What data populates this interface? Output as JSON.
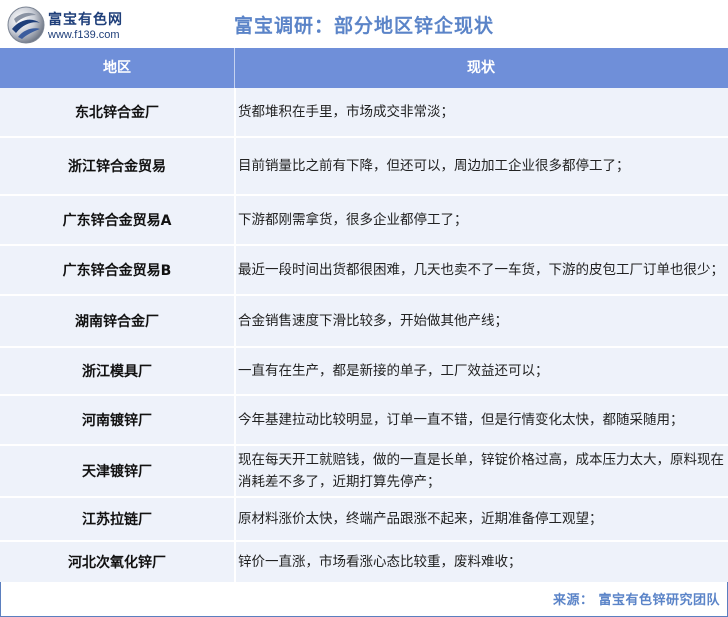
{
  "header": {
    "brand_name": "富宝有色网",
    "brand_url": "www.f139.com",
    "title": "富宝调研：部分地区锌企现状"
  },
  "table": {
    "columns": [
      "地区",
      "现状"
    ],
    "rows": [
      {
        "region": "东北锌合金厂",
        "status": "货都堆积在手里，市场成交非常淡；"
      },
      {
        "region": "浙江锌合金贸易",
        "status": "目前销量比之前有下降，但还可以，周边加工企业很多都停工了；"
      },
      {
        "region": "广东锌合金贸易A",
        "status": "下游都刚需拿货，很多企业都停工了；"
      },
      {
        "region": "广东锌合金贸易B",
        "status": "最近一段时间出货都很困难，几天也卖不了一车货，下游的皮包工厂订单也很少；"
      },
      {
        "region": "湖南锌合金厂",
        "status": "合金销售速度下滑比较多，开始做其他产线；"
      },
      {
        "region": "浙江模具厂",
        "status": "一直有在生产，都是新接的单子，工厂效益还可以；"
      },
      {
        "region": "河南镀锌厂",
        "status": "今年基建拉动比较明显，订单一直不错，但是行情变化太快，都随采随用；"
      },
      {
        "region": "天津镀锌厂",
        "status": "现在每天开工就赔钱，做的一直是长单，锌锭价格过高，成本压力太大，原料现在消耗差不多了，近期打算先停产；"
      },
      {
        "region": "江苏拉链厂",
        "status": "原材料涨价太快，终端产品跟涨不起来，近期准备停工观望；"
      },
      {
        "region": "河北次氧化锌厂",
        "status": "锌价一直涨，市场看涨心态比较重，废料难收；"
      }
    ]
  },
  "footer": {
    "source": "来源：  富宝有色锌研究团队"
  },
  "colors": {
    "header_bg": "#6f8fd9",
    "row_bg": "#eef2fa",
    "title": "#5b84c8",
    "brand": "#1f3f7a"
  }
}
